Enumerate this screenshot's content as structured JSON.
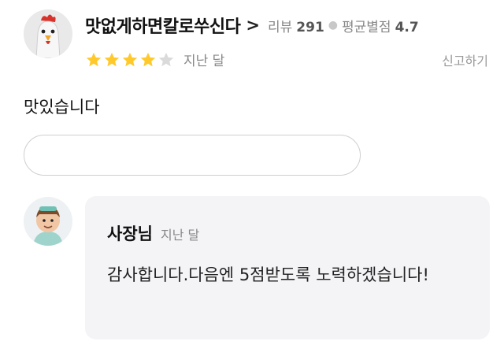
{
  "review": {
    "nickname": "맛없게하면칼로쑤신다",
    "review_count_label": "리뷰",
    "review_count": "291",
    "avg_rating_label": "평균별점",
    "avg_rating": "4.7",
    "stars_filled": 4,
    "stars_total": 5,
    "time": "지난 달",
    "report_label": "신고하기",
    "text": "맛있습니다"
  },
  "reply_input": {
    "placeholder": ""
  },
  "owner_reply": {
    "name": "사장님",
    "time": "지난 달",
    "text": "감사합니다.다음엔 5점받도록 노력하겠습니다!"
  },
  "colors": {
    "star_filled": "#FFC92C",
    "star_empty": "#DADADA",
    "reply_bg": "#F4F4F7"
  }
}
